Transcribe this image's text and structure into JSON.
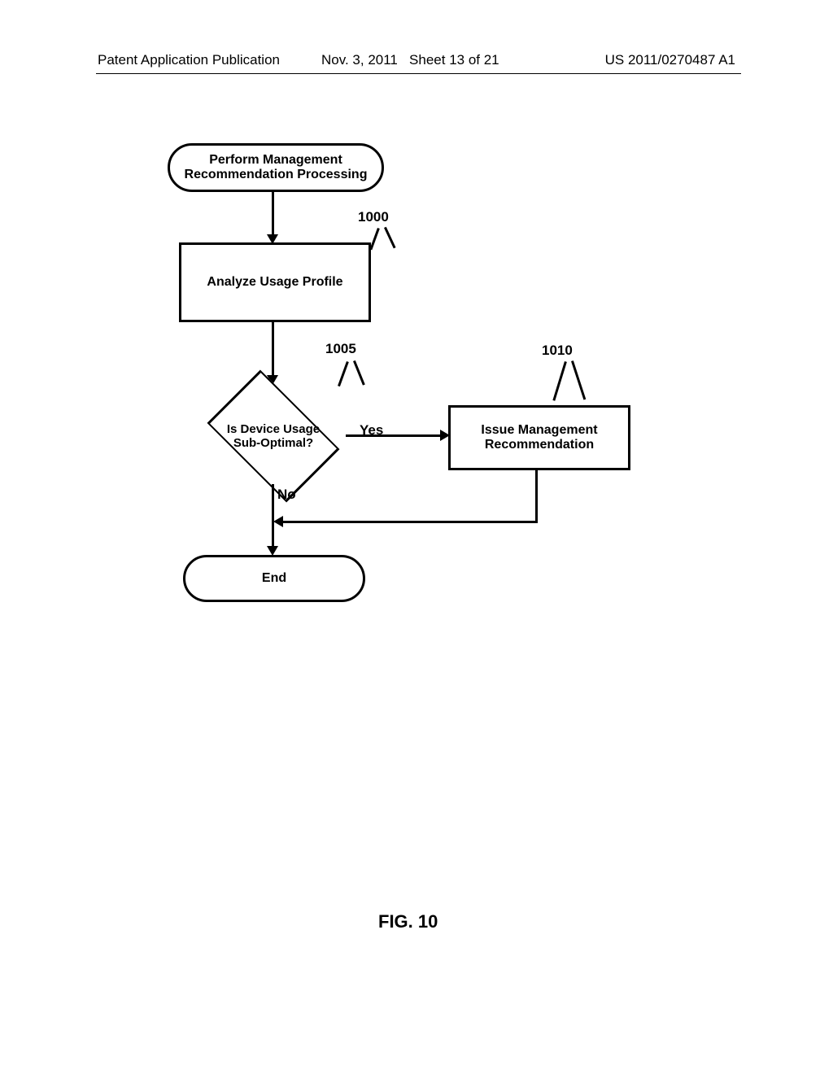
{
  "header": {
    "left": "Patent Application Publication",
    "center": "Nov. 3, 2011   Sheet 13 of 21",
    "right": "US 2011/0270487 A1"
  },
  "blocks": {
    "start": {
      "line1": "Perform Management",
      "line2": "Recommendation Processing"
    },
    "analyze": "Analyze Usage Profile",
    "decision": {
      "line1": "Is Device Usage",
      "line2": "Sub-Optimal?"
    },
    "issue": {
      "line1": "Issue Management",
      "line2": "Recommendation"
    },
    "end": "End"
  },
  "edges": {
    "yes": "Yes",
    "no": "No"
  },
  "refs": {
    "r1000": "1000",
    "r1005": "1005",
    "r1010": "1010"
  },
  "figure_caption": "FIG. 10"
}
